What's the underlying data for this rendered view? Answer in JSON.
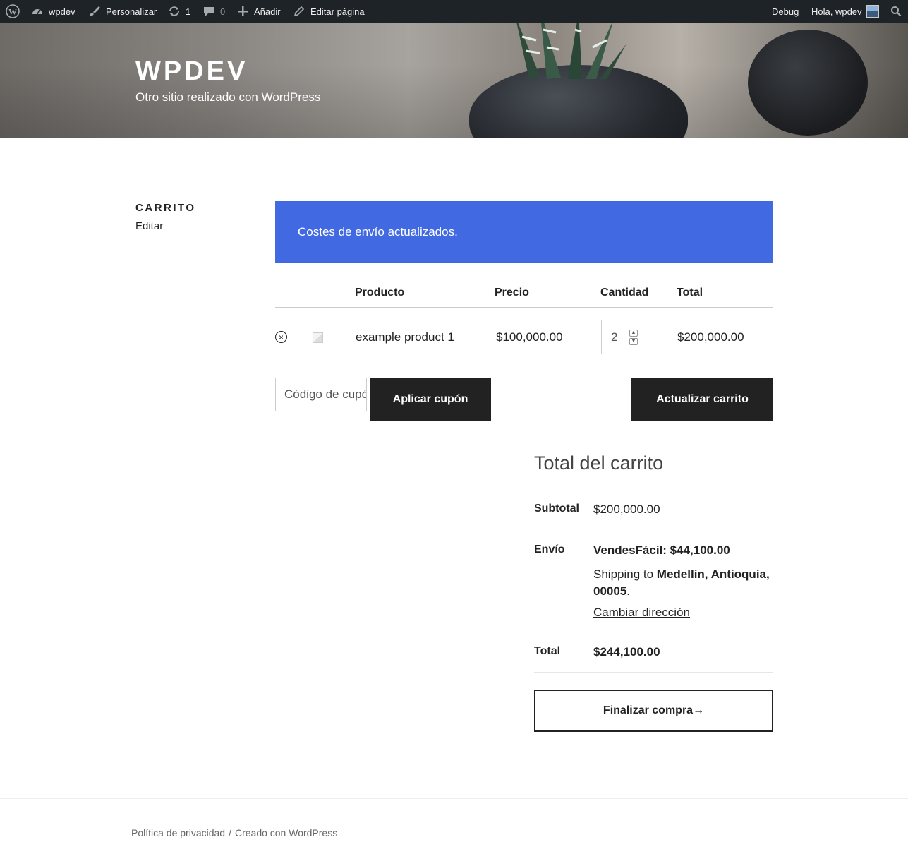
{
  "adminbar": {
    "site": "wpdev",
    "customize": "Personalizar",
    "updates": "1",
    "comments": "0",
    "add_new": "Añadir",
    "edit_page": "Editar página",
    "debug": "Debug",
    "greeting": "Hola, wpdev"
  },
  "header": {
    "site_title": "WPDEV",
    "tagline": "Otro sitio realizado con WordPress"
  },
  "sidebar": {
    "page_title": "CARRITO",
    "edit": "Editar"
  },
  "notice": "Costes de envío actualizados.",
  "cart": {
    "columns": {
      "product": "Producto",
      "price": "Precio",
      "quantity": "Cantidad",
      "total": "Total"
    },
    "items": [
      {
        "remove": "×",
        "name": "example product 1",
        "price": "$100,000.00",
        "quantity": "2",
        "total": "$200,000.00"
      }
    ],
    "coupon_placeholder": "Código de cupón",
    "apply_coupon": "Aplicar cupón",
    "update_cart": "Actualizar carrito"
  },
  "totals": {
    "title": "Total del carrito",
    "subtotal_label": "Subtotal",
    "subtotal_value": "$200,000.00",
    "shipping_label": "Envío",
    "shipping_method": "VendesFácil: $44,100.00",
    "shipping_to_prefix": "Shipping to ",
    "shipping_to_address": "Medellin, Antioquia, 00005",
    "shipping_to_suffix": ".",
    "change_address": "Cambiar dirección",
    "total_label": "Total",
    "total_value": "$244,100.00",
    "checkout": "Finalizar compra→"
  },
  "footer": {
    "privacy": "Política de privacidad",
    "separator": "/",
    "credit": "Creado con WordPress"
  }
}
